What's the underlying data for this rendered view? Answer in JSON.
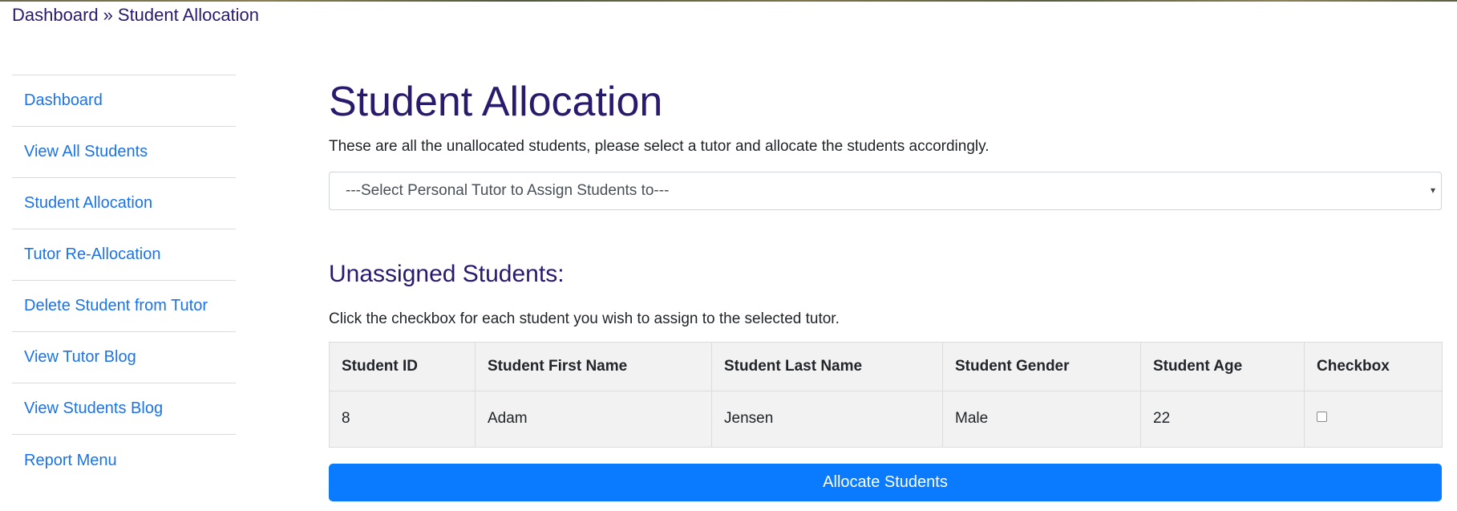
{
  "breadcrumb": {
    "home": "Dashboard",
    "separator": "»",
    "current": "Student Allocation"
  },
  "sidebar": {
    "items": [
      {
        "label": "Dashboard"
      },
      {
        "label": "View All Students"
      },
      {
        "label": "Student Allocation"
      },
      {
        "label": "Tutor Re-Allocation"
      },
      {
        "label": "Delete Student from Tutor"
      },
      {
        "label": "View Tutor Blog"
      },
      {
        "label": "View Students Blog"
      },
      {
        "label": "Report Menu"
      }
    ]
  },
  "main": {
    "title": "Student Allocation",
    "intro": "These are all the unallocated students, please select a tutor and allocate the students accordingly.",
    "tutor_select": {
      "selected": "---Select Personal Tutor to Assign Students to---"
    },
    "section_title": "Unassigned Students:",
    "section_desc": "Click the checkbox for each student you wish to assign to the selected tutor.",
    "table": {
      "headers": [
        "Student ID",
        "Student First Name",
        "Student Last Name",
        "Student Gender",
        "Student Age",
        "Checkbox"
      ],
      "rows": [
        {
          "id": "8",
          "first": "Adam",
          "last": "Jensen",
          "gender": "Male",
          "age": "22",
          "checked": false
        }
      ]
    },
    "allocate_label": "Allocate Students"
  },
  "colors": {
    "heading": "#2a1a6e",
    "link": "#1a73e8",
    "button": "#0a7bff"
  }
}
